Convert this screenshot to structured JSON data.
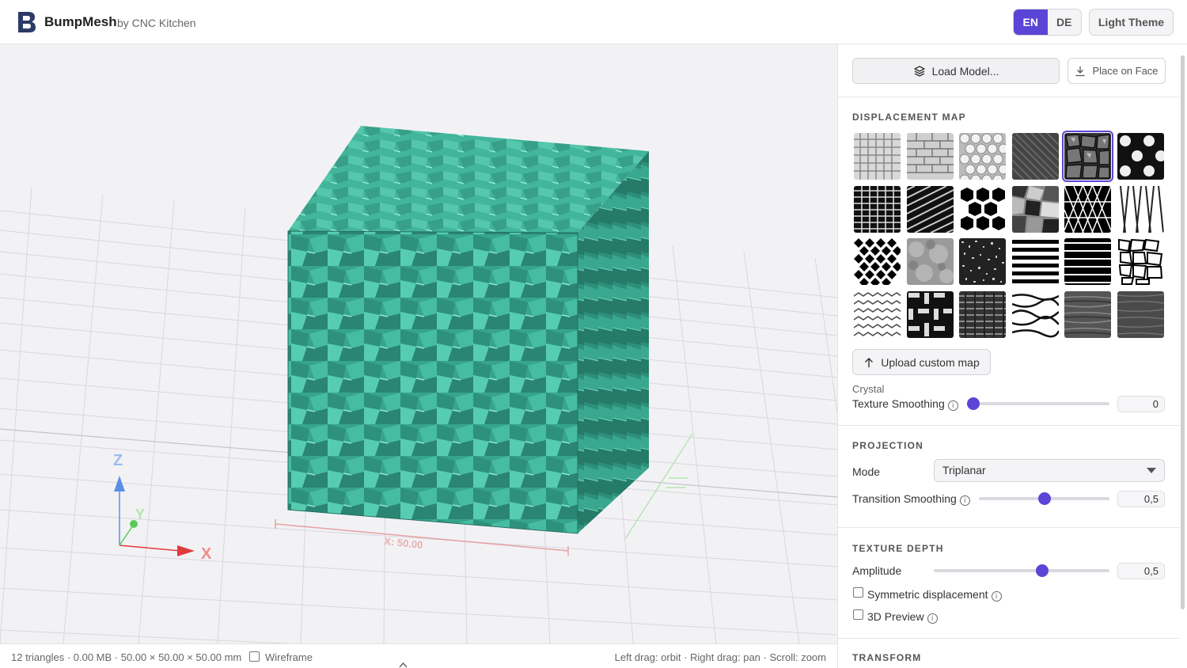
{
  "header": {
    "title": "BumpMesh",
    "subtitle": "by CNC Kitchen",
    "lang_en": "EN",
    "lang_de": "DE",
    "theme_button": "Light Theme"
  },
  "colors": {
    "accent": "#5b45d6",
    "mesh": "#3fb59c",
    "axis_x": "#e23b3b",
    "axis_y": "#5cc85a",
    "axis_z": "#5b8fe6"
  },
  "viewport": {
    "axis_x": "X",
    "axis_y": "Y",
    "axis_z": "Z",
    "dim_label": "X: 50.00"
  },
  "status": {
    "info": "12 triangles · 0.00 MB · 50.00 × 50.00 × 50.00 mm",
    "wireframe_label": "Wireframe",
    "wireframe_checked": false,
    "controls_hint": "Left drag: orbit  ·  Right drag: pan  ·  Scroll: zoom"
  },
  "panel": {
    "load_model": "Load Model...",
    "place_on_face": "Place on Face",
    "displacement_title": "DISPLACEMENT MAP",
    "textures": [
      "grid",
      "bricks",
      "circles",
      "carbon",
      "crystal",
      "dots",
      "weave-grid",
      "diagonal",
      "hexagons",
      "camo",
      "triangles",
      "knit",
      "diamonds",
      "noise",
      "speckle",
      "stripes",
      "stripes-thick",
      "voronoi",
      "zigzag",
      "basket",
      "mesh",
      "wood-rings",
      "wood-dark",
      "wood-grain"
    ],
    "selected_texture_index": 4,
    "upload_custom": "Upload custom map",
    "texture_name": "Crystal",
    "texture_smoothing_label": "Texture Smoothing",
    "texture_smoothing_value": "0",
    "projection_title": "PROJECTION",
    "mode_label": "Mode",
    "mode_value": "Triplanar",
    "transition_label": "Transition Smoothing",
    "transition_value": "0,5",
    "texture_depth_title": "TEXTURE DEPTH",
    "amplitude_label": "Amplitude",
    "amplitude_value": "0,5",
    "symmetric_label": "Symmetric displacement",
    "preview_label": "3D Preview",
    "transform_title": "TRANSFORM"
  }
}
